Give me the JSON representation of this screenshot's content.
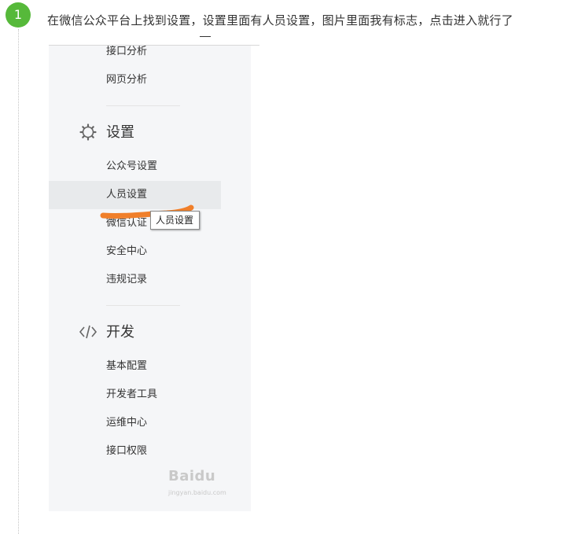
{
  "step": {
    "number": "1",
    "text": "在微信公众平台上找到设置，设置里面有人员设置，图片里面我有标志，点击进入就行了",
    "badge_color": "#56b93a"
  },
  "sidebar": {
    "items_top": [
      {
        "label": "接口分析"
      },
      {
        "label": "网页分析"
      }
    ],
    "settings": {
      "title": "设置",
      "icon": "gear-icon",
      "items": [
        {
          "label": "公众号设置"
        },
        {
          "label": "人员设置",
          "active": true
        },
        {
          "label": "微信认证"
        },
        {
          "label": "安全中心"
        },
        {
          "label": "违规记录"
        }
      ]
    },
    "develop": {
      "title": "开发",
      "icon": "code-icon",
      "items": [
        {
          "label": "基本配置"
        },
        {
          "label": "开发者工具"
        },
        {
          "label": "运维中心"
        },
        {
          "label": "接口权限"
        }
      ]
    }
  },
  "tooltip": {
    "text": "人员设置"
  },
  "annotation": {
    "stroke_color": "#f07f2a"
  },
  "watermark": {
    "logo": "Baidu",
    "sub": "jingyan.baidu.com"
  }
}
